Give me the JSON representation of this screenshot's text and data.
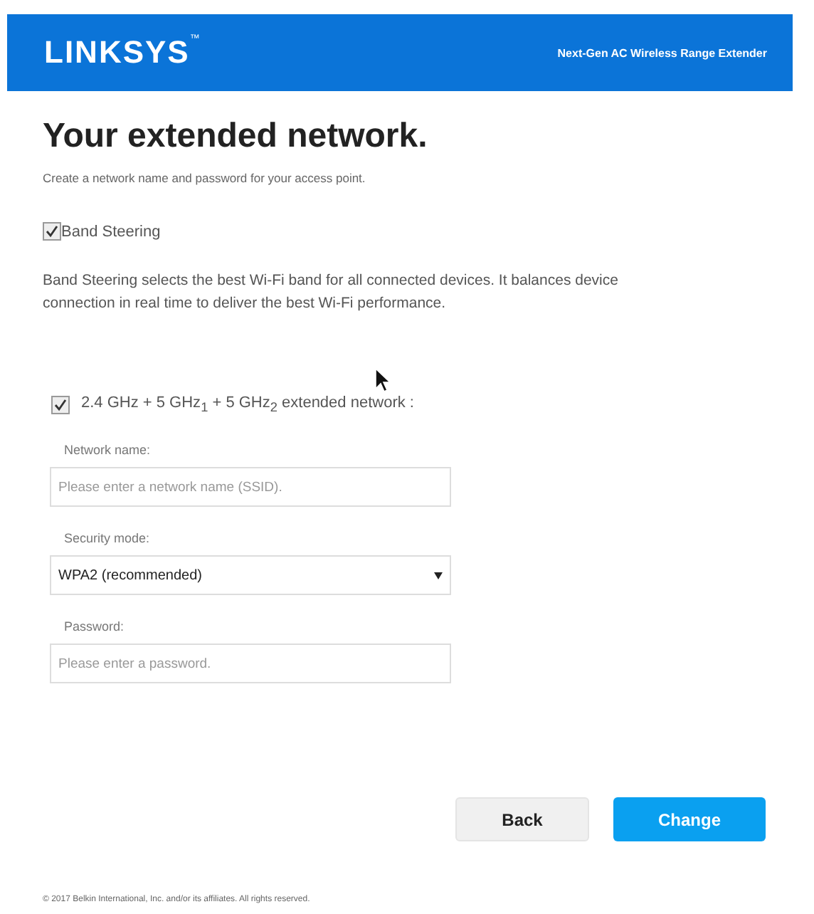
{
  "header": {
    "logo": "LINKSYS",
    "trademark": "™",
    "product": "Next-Gen AC Wireless Range Extender"
  },
  "title": "Your extended network.",
  "subtitle": "Create a network name and password for your access point.",
  "band_steering": {
    "label": "Band Steering",
    "checked": true,
    "description": "Band Steering selects the best Wi-Fi band for all connected devices. It balances device connection in real time to deliver the best Wi-Fi performance."
  },
  "network": {
    "label": "2.4 GHz + 5 GHz$_{1}$ + 5 GHz$_{2}$ extended network :",
    "checked": true
  },
  "fields": [
    {
      "kind": "text",
      "label": "Network name:",
      "placeholder": "Please enter a network name (SSID)."
    },
    {
      "kind": "select",
      "label": "Security mode:",
      "value": "WPA2 (recommended)"
    },
    {
      "kind": "text",
      "label": "Password:",
      "placeholder": "Please enter a password."
    }
  ],
  "buttons": [
    {
      "label": "Back",
      "kind": "secondary"
    },
    {
      "label": "Change",
      "kind": "primary"
    }
  ],
  "footer": "© 2017 Belkin International, Inc. and/or its affiliates. All rights reserved."
}
